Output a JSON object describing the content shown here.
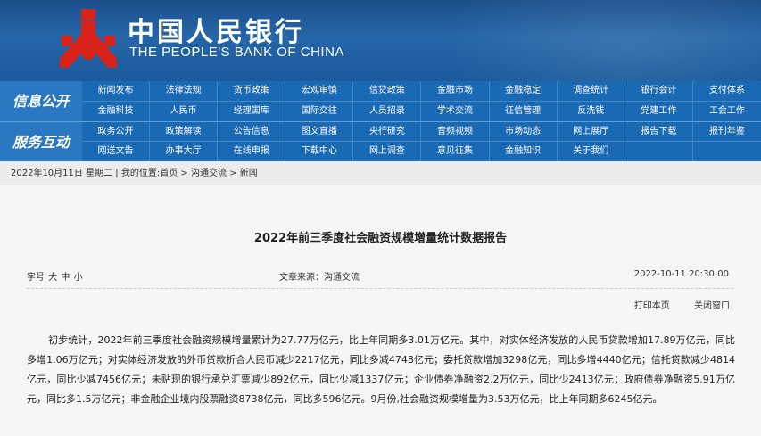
{
  "header": {
    "title_cn": "中国人民银行",
    "title_en": "THE PEOPLE'S BANK OF CHINA",
    "colors": {
      "banner": "#1d4f8c",
      "nav": "#1a69b5",
      "emblem": "#d9221a"
    }
  },
  "nav": {
    "info_label": "信息公开",
    "service_label": "服务互动",
    "row1": [
      "新闻发布",
      "法律法规",
      "货币政策",
      "宏观审慎",
      "信贷政策",
      "金融市场",
      "金融稳定",
      "调查统计",
      "银行会计",
      "支付体系"
    ],
    "row2": [
      "金融科技",
      "人民币",
      "经理国库",
      "国际交往",
      "人员招录",
      "学术交流",
      "征信管理",
      "反洗钱",
      "党建工作",
      "工会工作"
    ],
    "row3": [
      "政务公开",
      "政策解读",
      "公告信息",
      "图文直播",
      "央行研究",
      "音频视频",
      "市场动态",
      "网上展厅",
      "报告下载",
      "报刊年鉴"
    ],
    "row4": [
      "网送文告",
      "办事大厅",
      "在线申报",
      "下载中心",
      "网上调查",
      "意见征集",
      "金融知识",
      "关于我们"
    ]
  },
  "breadcrumb": {
    "date": "2022年10月11日 星期二",
    "location_prefix": "我的位置:",
    "home": "首页",
    "sep": ">",
    "section": "沟通交流",
    "current": "新闻"
  },
  "article": {
    "title": "2022年前三季度社会融资规模增量统计数据报告",
    "font_size_label": "字号",
    "font_sizes": [
      "大",
      "中",
      "小"
    ],
    "source": "文章来源：沟通交流",
    "datetime": "2022-10-11 20:30:00",
    "print": "打印本页",
    "close": "关闭窗口",
    "body": "初步统计，2022年前三季度社会融资规模增量累计为27.77万亿元，比上年同期多3.01万亿元。其中，对实体经济发放的人民币贷款增加17.89万亿元，同比多增1.06万亿元；对实体经济发放的外币贷款折合人民币减少2217亿元，同比多减4748亿元；委托贷款增加3298亿元，同比多增4440亿元；信托贷款减少4814亿元，同比少减7456亿元；未贴现的银行承兑汇票减少892亿元，同比少减1337亿元；企业债券净融资2.2万亿元，同比少2413亿元；政府债券净融资5.91万亿元，同比多1.5万亿元；非金融企业境内股票融资8738亿元，同比多596亿元。9月份,社会融资规模增量为3.53万亿元，比上年同期多6245亿元。"
  }
}
